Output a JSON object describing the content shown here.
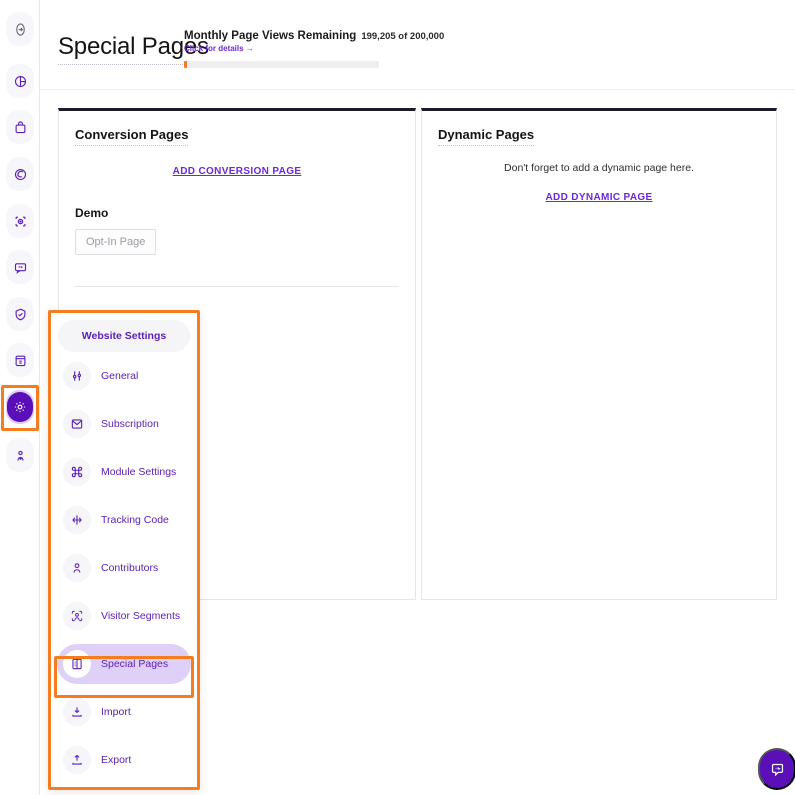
{
  "header": {
    "page_title": "Special Pages",
    "quota": {
      "label": "Monthly Page Views Remaining",
      "count": "199,205 of 200,000",
      "details_link": "Click for details →",
      "fill_percent": 1,
      "fill_color": "#f57c1f",
      "track_color": "#eeeef1"
    }
  },
  "rail": {
    "items": [
      {
        "name": "dashboard-icon",
        "label": "Dashboard"
      },
      {
        "name": "analytics-pie-icon",
        "label": "Analytics"
      },
      {
        "name": "shopping-bag-icon",
        "label": "Commerce"
      },
      {
        "name": "funnel-spiral-icon",
        "label": "Funnels"
      },
      {
        "name": "target-scan-icon",
        "label": "Goals"
      },
      {
        "name": "chat-bubble-icon",
        "label": "Messages"
      },
      {
        "name": "shield-check-icon",
        "label": "Privacy"
      },
      {
        "name": "archive-box-icon",
        "label": "Records"
      },
      {
        "name": "gear-icon",
        "label": "Settings"
      },
      {
        "name": "user-pin-icon",
        "label": "Account"
      }
    ],
    "active_index": 8,
    "highlight_color": "#f57c1f",
    "active_bg": "#5a0fb8",
    "active_halo": "#ddcdf5"
  },
  "settings_menu": {
    "header_label": "Website Settings",
    "highlight_color": "#f57c1f",
    "selected_bg": "#dfd0f7",
    "accent": "#5b21b6",
    "items": [
      {
        "label": "General",
        "icon": "sliders-icon",
        "selected": false
      },
      {
        "label": "Subscription",
        "icon": "envelope-icon",
        "selected": false
      },
      {
        "label": "Module Settings",
        "icon": "command-grid-icon",
        "selected": false
      },
      {
        "label": "Tracking Code",
        "icon": "crosshair-plus-icon",
        "selected": false
      },
      {
        "label": "Contributors",
        "icon": "person-icon",
        "selected": false
      },
      {
        "label": "Visitor Segments",
        "icon": "person-scan-icon",
        "selected": false
      },
      {
        "label": "Special Pages",
        "icon": "special-pages-icon",
        "selected": true
      },
      {
        "label": "Import",
        "icon": "download-icon",
        "selected": false
      },
      {
        "label": "Export",
        "icon": "upload-icon",
        "selected": false
      }
    ]
  },
  "main": {
    "conversion_card": {
      "title": "Conversion Pages",
      "add_link": "ADD CONVERSION PAGE",
      "group_name": "Demo",
      "chip_label": "Opt-In Page"
    },
    "dynamic_card": {
      "title": "Dynamic Pages",
      "empty_text": "Don't forget to add a dynamic page here.",
      "add_link": "ADD DYNAMIC PAGE"
    }
  },
  "chat_fab": {
    "icon": "chat-support-icon",
    "color": "#5a0fb8"
  }
}
